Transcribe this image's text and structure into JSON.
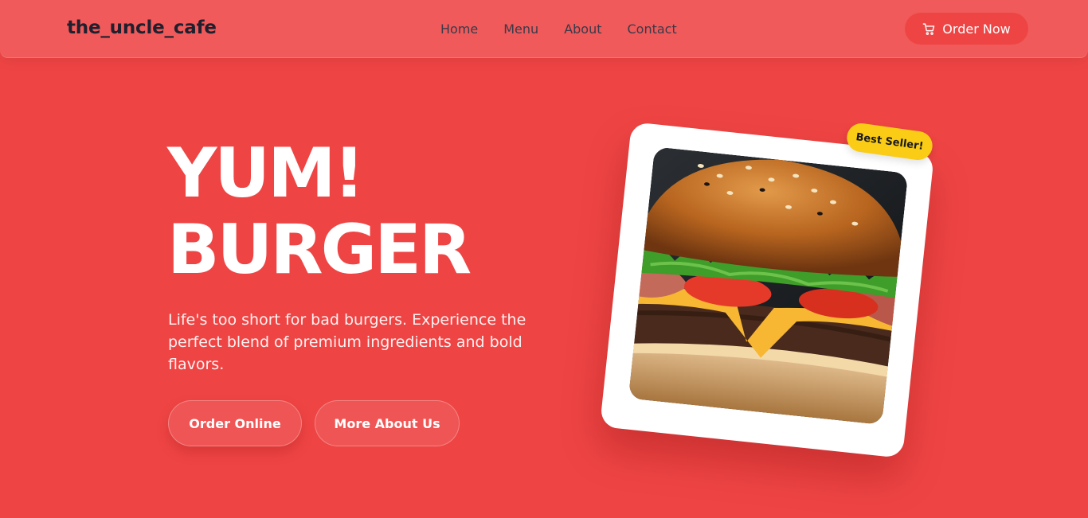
{
  "header": {
    "brand": "the_uncle_cafe",
    "nav": [
      {
        "label": "Home"
      },
      {
        "label": "Menu"
      },
      {
        "label": "About"
      },
      {
        "label": "Contact"
      }
    ],
    "cta_label": "Order Now",
    "cta_icon": "cart-icon"
  },
  "hero": {
    "title_line1": "YUM!",
    "title_line2": "BURGER",
    "subtitle": "Life's too short for bad burgers. Experience the perfect blend of premium ingredients and bold flavors.",
    "primary_button": "Order Online",
    "secondary_button": "More About Us",
    "badge": "Best Seller!"
  },
  "colors": {
    "background": "#ef4444",
    "navbar": "#f05a5a",
    "badge": "#facc15",
    "text_light": "#ffffff",
    "text_dark": "#1f1f2e"
  }
}
